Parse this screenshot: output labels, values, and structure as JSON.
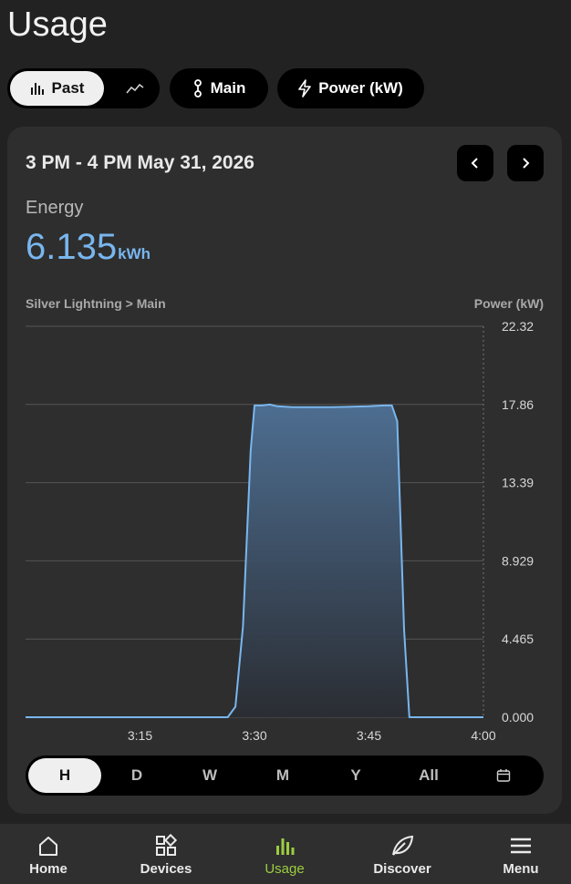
{
  "page": {
    "title": "Usage"
  },
  "filters": {
    "mode_past_label": "Past",
    "circuit_label": "Main",
    "metric_label": "Power (kW)"
  },
  "card": {
    "range_title": "3 PM - 4 PM May 31, 2026",
    "metric_label": "Energy",
    "metric_value": "6.135",
    "metric_unit": "kWh",
    "source": "Silver Lightning > Main",
    "axis_title": "Power (kW)"
  },
  "chart_data": {
    "type": "area",
    "x_ticks": [
      "3:15",
      "3:30",
      "3:45",
      "4:00"
    ],
    "y_ticks": [
      "0.000",
      "4.465",
      "8.929",
      "13.39",
      "17.86",
      "22.32"
    ],
    "ylim": [
      0,
      22.32
    ],
    "xlim_minutes": [
      0,
      60
    ],
    "x_minutes": [
      0,
      5,
      10,
      15,
      20,
      25,
      26.5,
      27.5,
      28.5,
      29.5,
      30,
      31,
      32,
      33,
      35,
      40,
      45,
      47,
      48,
      48.7,
      49.6,
      50.3,
      52,
      55,
      60
    ],
    "values": [
      0,
      0,
      0,
      0,
      0,
      0,
      0,
      0.6,
      5.2,
      15.2,
      17.8,
      17.8,
      17.85,
      17.75,
      17.7,
      17.7,
      17.75,
      17.8,
      17.8,
      16.9,
      5.0,
      0,
      0,
      0,
      0
    ],
    "color": "#79b6ee"
  },
  "periods": [
    "H",
    "D",
    "W",
    "M",
    "Y",
    "All"
  ],
  "active_period": "H",
  "bottom_nav": [
    {
      "label": "Home",
      "icon": "home-icon"
    },
    {
      "label": "Devices",
      "icon": "devices-icon"
    },
    {
      "label": "Usage",
      "icon": "usage-icon",
      "active": true
    },
    {
      "label": "Discover",
      "icon": "leaf-icon"
    },
    {
      "label": "Menu",
      "icon": "menu-icon"
    }
  ],
  "colors": {
    "accent_blue": "#79b6ee",
    "active_green": "#9ccc40"
  }
}
